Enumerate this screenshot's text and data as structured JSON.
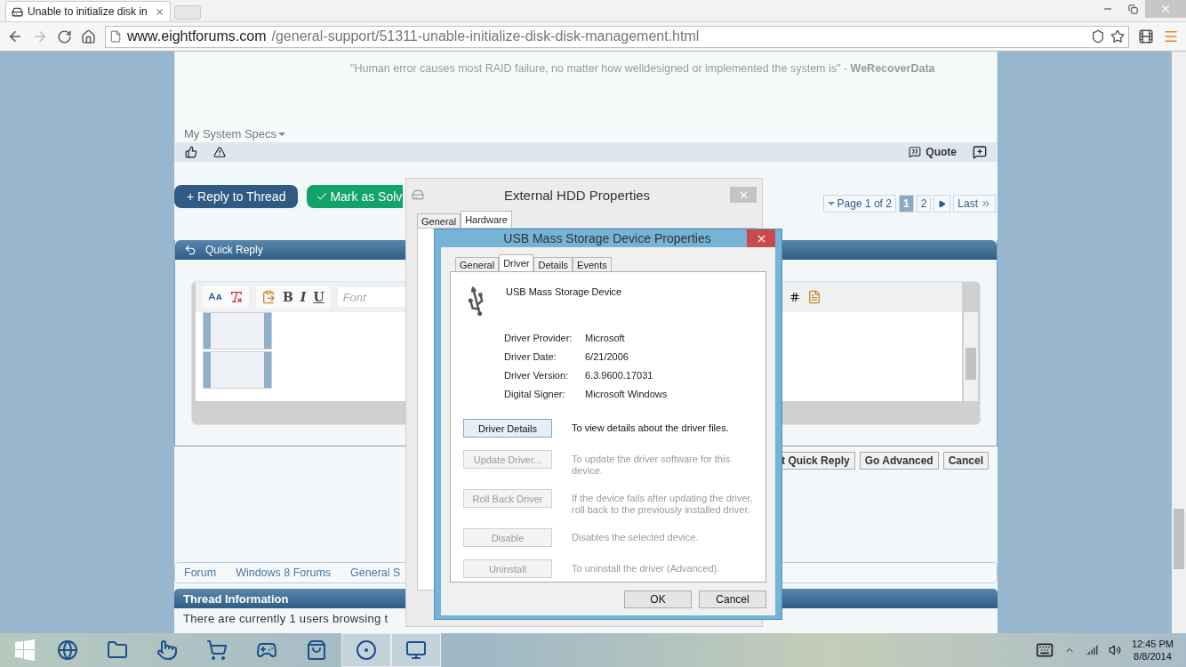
{
  "browser": {
    "tab_title": "Unable to initialize disk in",
    "url_host": "www.eightforums.com",
    "url_path": "/general-support/51311-unable-initialize-disk-disk-management.html"
  },
  "post": {
    "signature": "\"Human error causes most RAID failure, no matter how welldesigned or implemented the system is\" - **WeRecoverData**",
    "specs_label": "My System Specs",
    "quote_button": "Quote"
  },
  "thread_actions": {
    "reply": "+ Reply to Thread",
    "mark_solved": "Mark as Solv"
  },
  "pagination": {
    "label": "Page 1 of 2",
    "pages": [
      {
        "label": "1",
        "selected": true
      },
      {
        "label": "2",
        "selected": false
      }
    ],
    "last": "Last"
  },
  "quick_reply": {
    "title": "Quick Reply",
    "format_buttons": [
      "B",
      "I",
      "U"
    ],
    "font_placeholder": "Font",
    "buttons": [
      "t Quick Reply",
      "Go Advanced",
      "Cancel"
    ]
  },
  "breadcrumbs": [
    "Forum",
    "Windows 8 Forums",
    "General S"
  ],
  "thread_info": {
    "title": "Thread Information",
    "text": "There are currently 1 users browsing t"
  },
  "back_dialog": {
    "title": "External HDD Properties",
    "tabs": [
      {
        "label": "General",
        "selected": false
      },
      {
        "label": "Hardware",
        "selected": true
      }
    ]
  },
  "dialog": {
    "title": "USB Mass Storage Device Properties",
    "tabs": [
      {
        "label": "General",
        "selected": false
      },
      {
        "label": "Driver",
        "selected": true
      },
      {
        "label": "Details",
        "selected": false
      },
      {
        "label": "Events",
        "selected": false
      }
    ],
    "device_name": "USB Mass Storage Device",
    "fields": [
      {
        "label": "Driver Provider:",
        "value": "Microsoft"
      },
      {
        "label": "Driver Date:",
        "value": "6/21/2006"
      },
      {
        "label": "Driver Version:",
        "value": "6.3.9600.17031"
      },
      {
        "label": "Digital Signer:",
        "value": "Microsoft Windows"
      }
    ],
    "actions": [
      {
        "button": "Driver Details",
        "description": "To view details about the driver files.",
        "disabled": false
      },
      {
        "button": "Update Driver...",
        "description": "To update the driver software for this device.",
        "disabled": true
      },
      {
        "button": "Roll Back Driver",
        "description": "If the device fails after updating the driver, roll back to the previously installed driver.",
        "disabled": true
      },
      {
        "button": "Disable",
        "description": "Disables the selected device.",
        "disabled": true
      },
      {
        "button": "Uninstall",
        "description": "To uninstall the driver (Advanced).",
        "disabled": true
      }
    ],
    "buttons": [
      "OK",
      "Cancel"
    ]
  },
  "taskbar": {
    "apps": [
      {
        "kind": "ie",
        "running": false
      },
      {
        "kind": "explorer",
        "running": false
      },
      {
        "kind": "touch",
        "running": false
      },
      {
        "kind": "amazon",
        "running": false
      },
      {
        "kind": "game",
        "running": false
      },
      {
        "kind": "store",
        "running": false
      },
      {
        "kind": "chrome",
        "running": true
      },
      {
        "kind": "devices",
        "running": true
      }
    ],
    "time": "12:45 PM",
    "date": "8/8/2014"
  }
}
